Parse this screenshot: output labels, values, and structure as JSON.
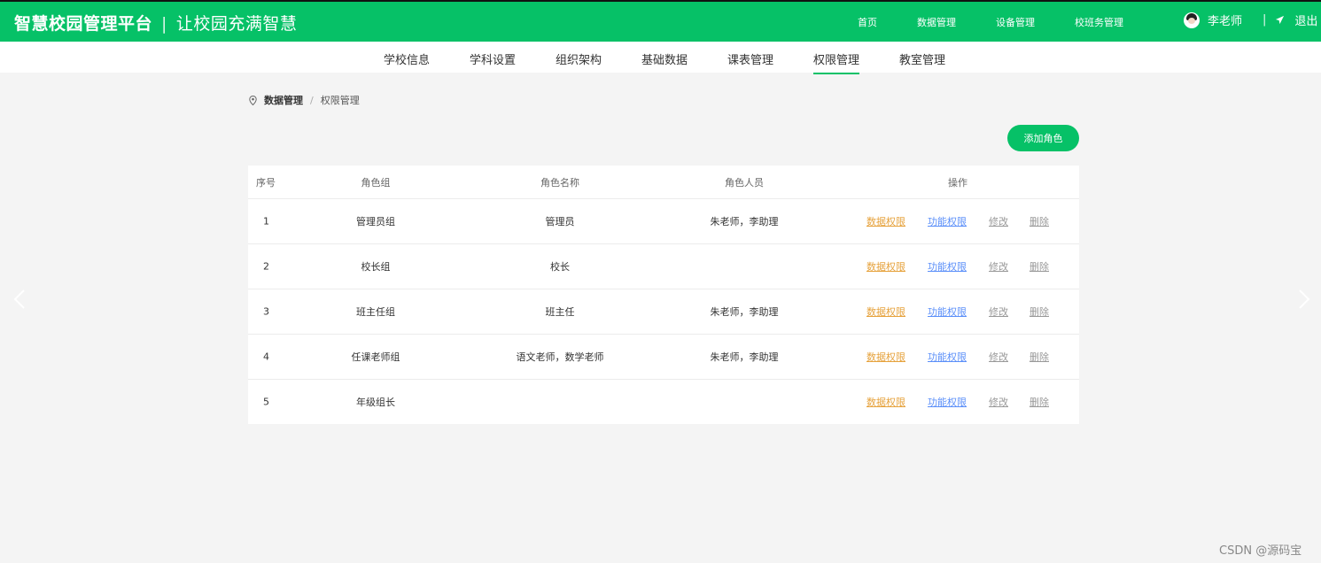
{
  "header": {
    "brand": "智慧校园管理平台",
    "separator": "|",
    "slogan": "让校园充满智慧",
    "nav": [
      "首页",
      "数据管理",
      "设备管理",
      "校班务管理"
    ],
    "user_name": "李老师",
    "divider": "|",
    "logout": "退出"
  },
  "subnav": {
    "tabs": [
      "学校信息",
      "学科设置",
      "组织架构",
      "基础数据",
      "课表管理",
      "权限管理",
      "教室管理"
    ],
    "active_index": 5
  },
  "breadcrumb": {
    "home": "数据管理",
    "separator": "/",
    "current": "权限管理"
  },
  "add_button": "添加角色",
  "table": {
    "headers": [
      "序号",
      "角色组",
      "角色名称",
      "角色人员",
      "操作"
    ],
    "rows": [
      {
        "idx": "1",
        "group": "管理员组",
        "name": "管理员",
        "members": "朱老师，李助理"
      },
      {
        "idx": "2",
        "group": "校长组",
        "name": "校长",
        "members": ""
      },
      {
        "idx": "3",
        "group": "班主任组",
        "name": "班主任",
        "members": "朱老师，李助理"
      },
      {
        "idx": "4",
        "group": "任课老师组",
        "name": "语文老师，数学老师",
        "members": "朱老师，李助理"
      },
      {
        "idx": "5",
        "group": "年级组长",
        "name": "",
        "members": ""
      }
    ],
    "actions": {
      "data": "数据权限",
      "func": "功能权限",
      "edit": "修改",
      "del": "删除"
    }
  },
  "watermark": "CSDN @源码宝",
  "colors": {
    "primary": "#06c167",
    "data_action": "#e6a23c",
    "func_action": "#5b8ff9"
  }
}
